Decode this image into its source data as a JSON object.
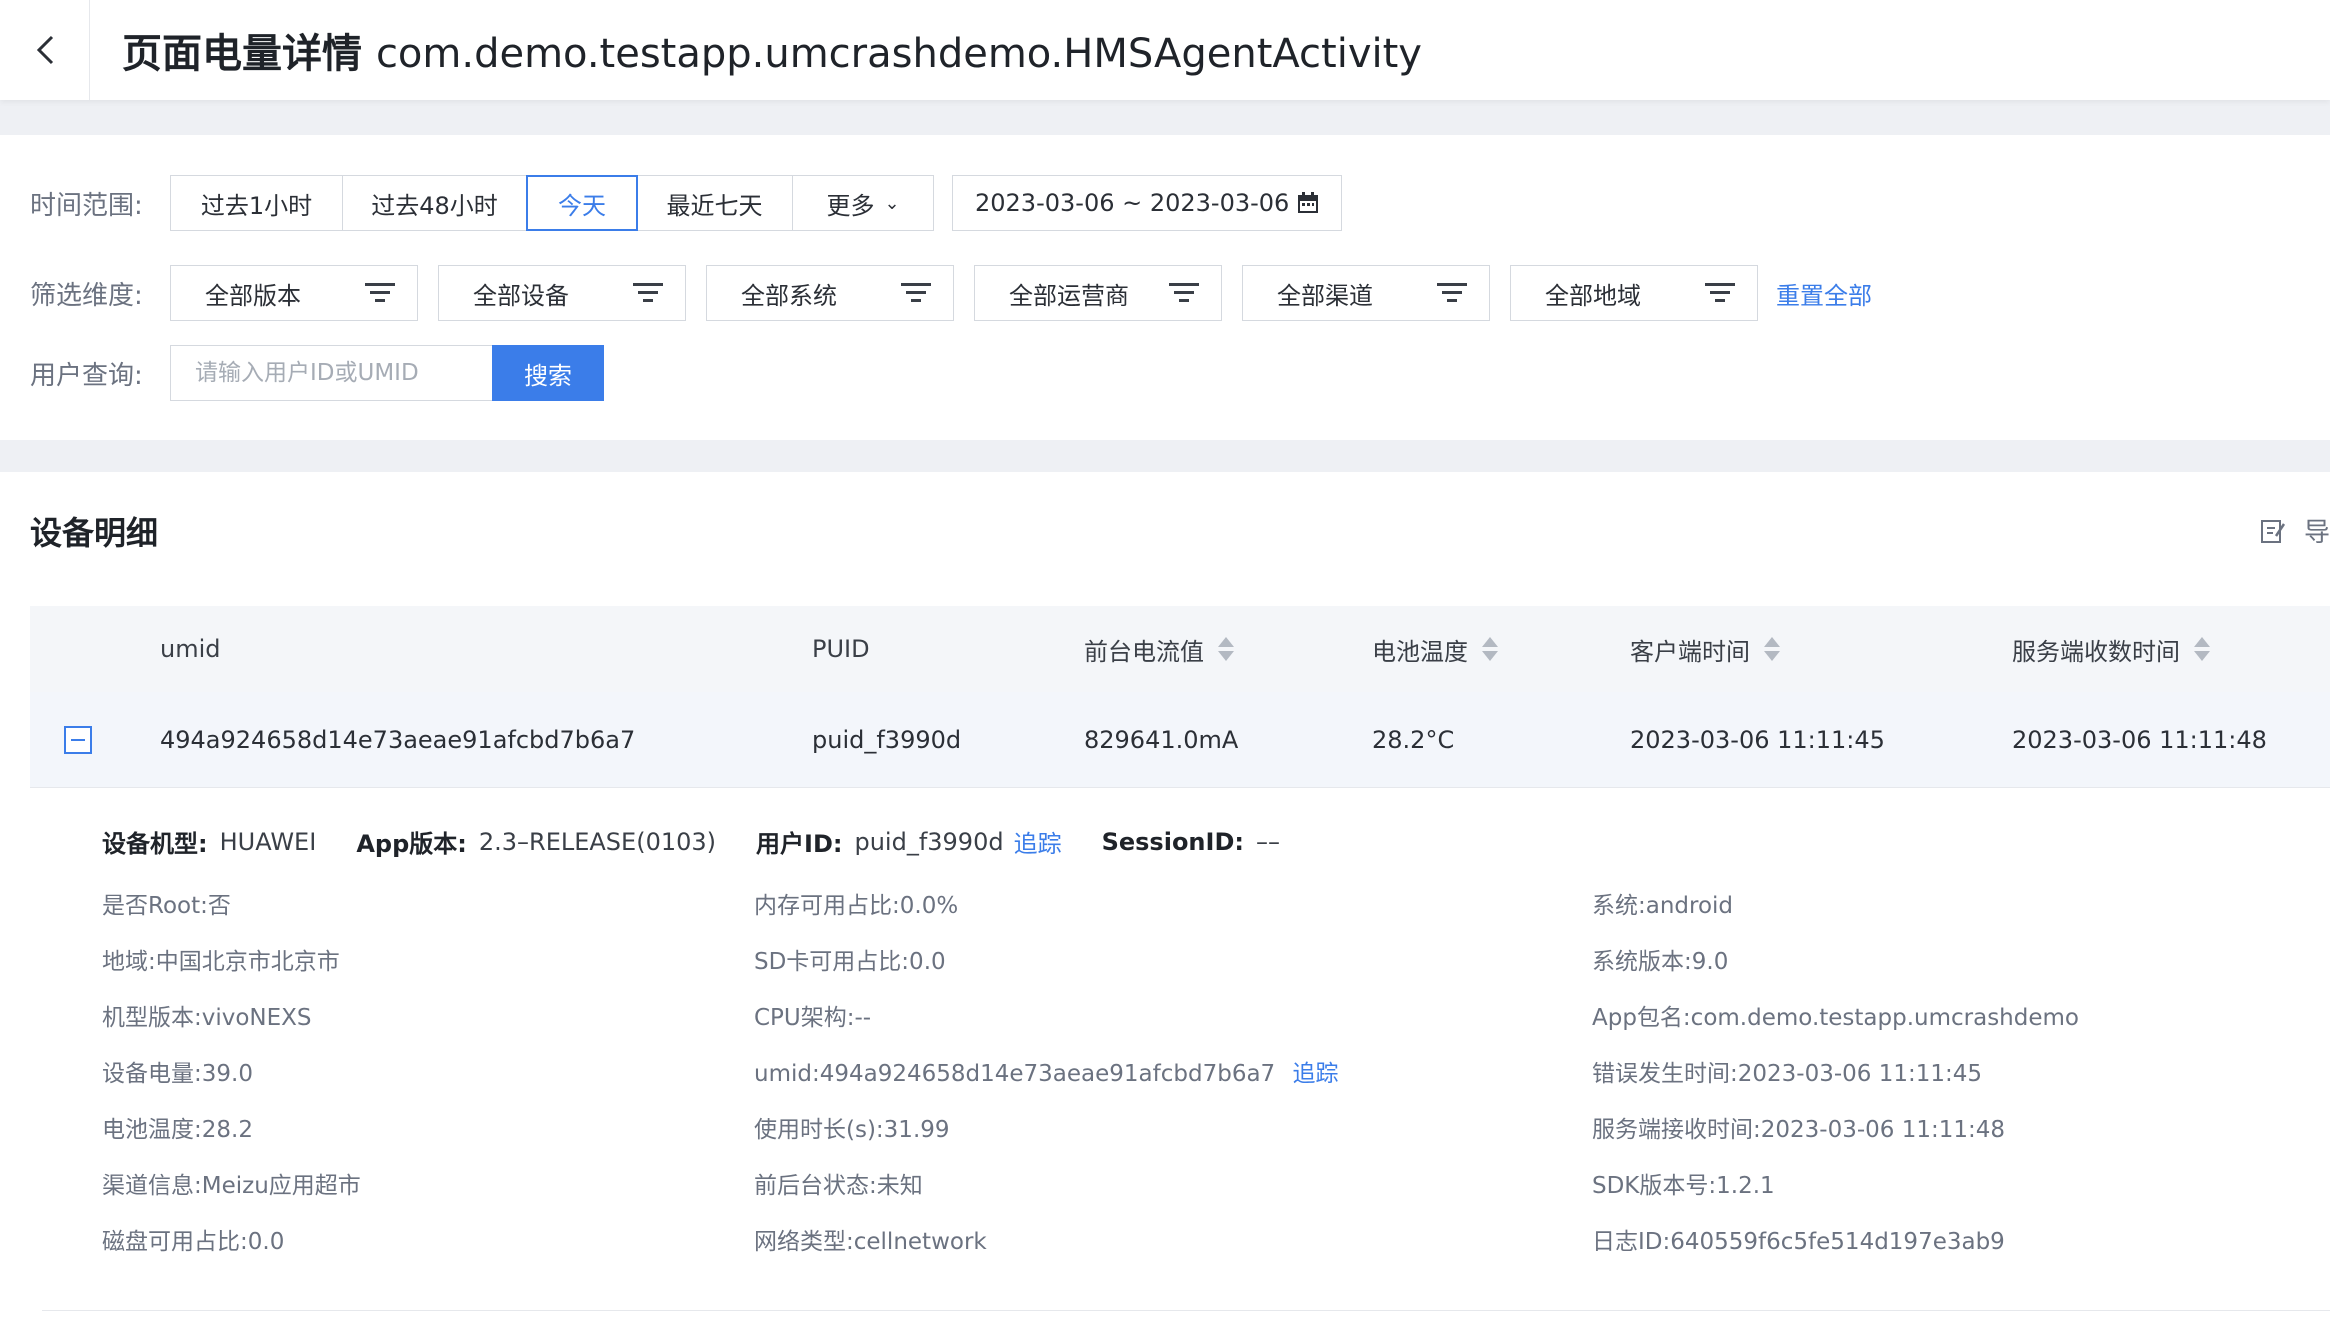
{
  "header": {
    "title_prefix": "页面电量详情",
    "title_activity": "com.demo.testapp.umcrashdemo.HMSAgentActivity"
  },
  "filters": {
    "time_label": "时间范围:",
    "time_options": [
      "过去1小时",
      "过去48小时",
      "今天",
      "最近七天",
      "更多"
    ],
    "active_time": "今天",
    "date_range": "2023-03-06 ~ 2023-03-06",
    "dimension_label": "筛选维度:",
    "dimensions": [
      "全部版本",
      "全部设备",
      "全部系统",
      "全部运营商",
      "全部渠道",
      "全部地域"
    ],
    "reset_label": "重置全部",
    "user_label": "用户查询:",
    "search_placeholder": "请输入用户ID或UMID",
    "search_button": "搜索"
  },
  "section": {
    "title": "设备明细",
    "icon_text": "导"
  },
  "table": {
    "headers": [
      "umid",
      "PUID",
      "前台电流值",
      "电池温度",
      "客户端时间",
      "服务端收数时间"
    ],
    "row": [
      "494a924658d14e73aeae91afcbd7b6a7",
      "puid_f3990d",
      "829641.0mA",
      "28.2°C",
      "2023-03-06 11:11:45",
      "2023-03-06 11:11:48"
    ]
  },
  "detail": {
    "line1": [
      {
        "k": "设备机型:",
        "v": "HUAWEI"
      },
      {
        "k": "App版本:",
        "v": "2.3–RELEASE(0103)"
      },
      {
        "k": "用户ID:",
        "v": "puid_f3990d"
      },
      {
        "k": "SessionID:",
        "v": "––"
      }
    ],
    "track_label": "追踪",
    "col1": [
      "是否Root:否",
      "地域:中国北京市北京市",
      "机型版本:vivoNEXS",
      "设备电量:39.0",
      "电池温度:28.2",
      "渠道信息:Meizu应用超市",
      "磁盘可用占比:0.0"
    ],
    "col2": [
      "内存可用占比:0.0%",
      "SD卡可用占比:0.0",
      "CPU架构:--",
      "umid:494a924658d14e73aeae91afcbd7b6a7",
      "使用时长(s):31.99",
      "前后台状态:未知",
      "网络类型:cellnetwork"
    ],
    "col3": [
      "系统:android",
      "系统版本:9.0",
      "App包名:com.demo.testapp.umcrashdemo",
      "错误发生时间:2023-03-06 11:11:45",
      "服务端接收时间:2023-03-06 11:11:48",
      "SDK版本号:1.2.1",
      "日志ID:640559f6c5fe514d197e3ab9"
    ]
  }
}
